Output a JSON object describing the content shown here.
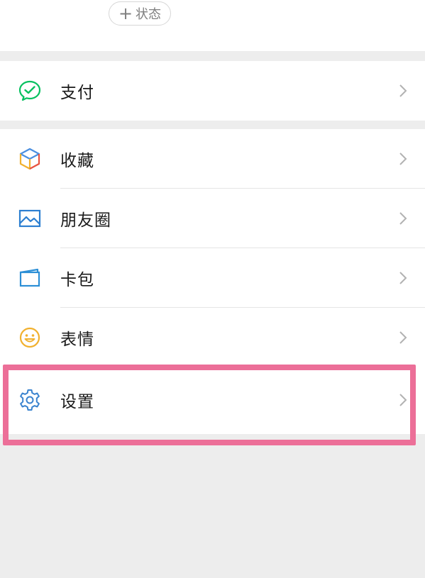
{
  "header": {
    "status_plus": "+",
    "status_label": "状态"
  },
  "pay_group": {
    "items": [
      {
        "label": "支付",
        "icon": "wechat-pay-icon"
      }
    ]
  },
  "tools_group": {
    "items": [
      {
        "label": "收藏",
        "icon": "favorites-cube-icon"
      },
      {
        "label": "朋友圈",
        "icon": "moments-picture-icon"
      },
      {
        "label": "卡包",
        "icon": "card-wallet-icon"
      },
      {
        "label": "表情",
        "icon": "smiley-icon"
      }
    ]
  },
  "settings_group": {
    "items": [
      {
        "label": "设置",
        "icon": "gear-icon"
      }
    ]
  },
  "colors": {
    "background": "#ededed",
    "highlight": "#ec6f98",
    "pay_green": "#07c160",
    "moments_blue": "#2c7fd1",
    "smiley_yellow": "#f1b12f",
    "settings_blue": "#3a83cf"
  }
}
